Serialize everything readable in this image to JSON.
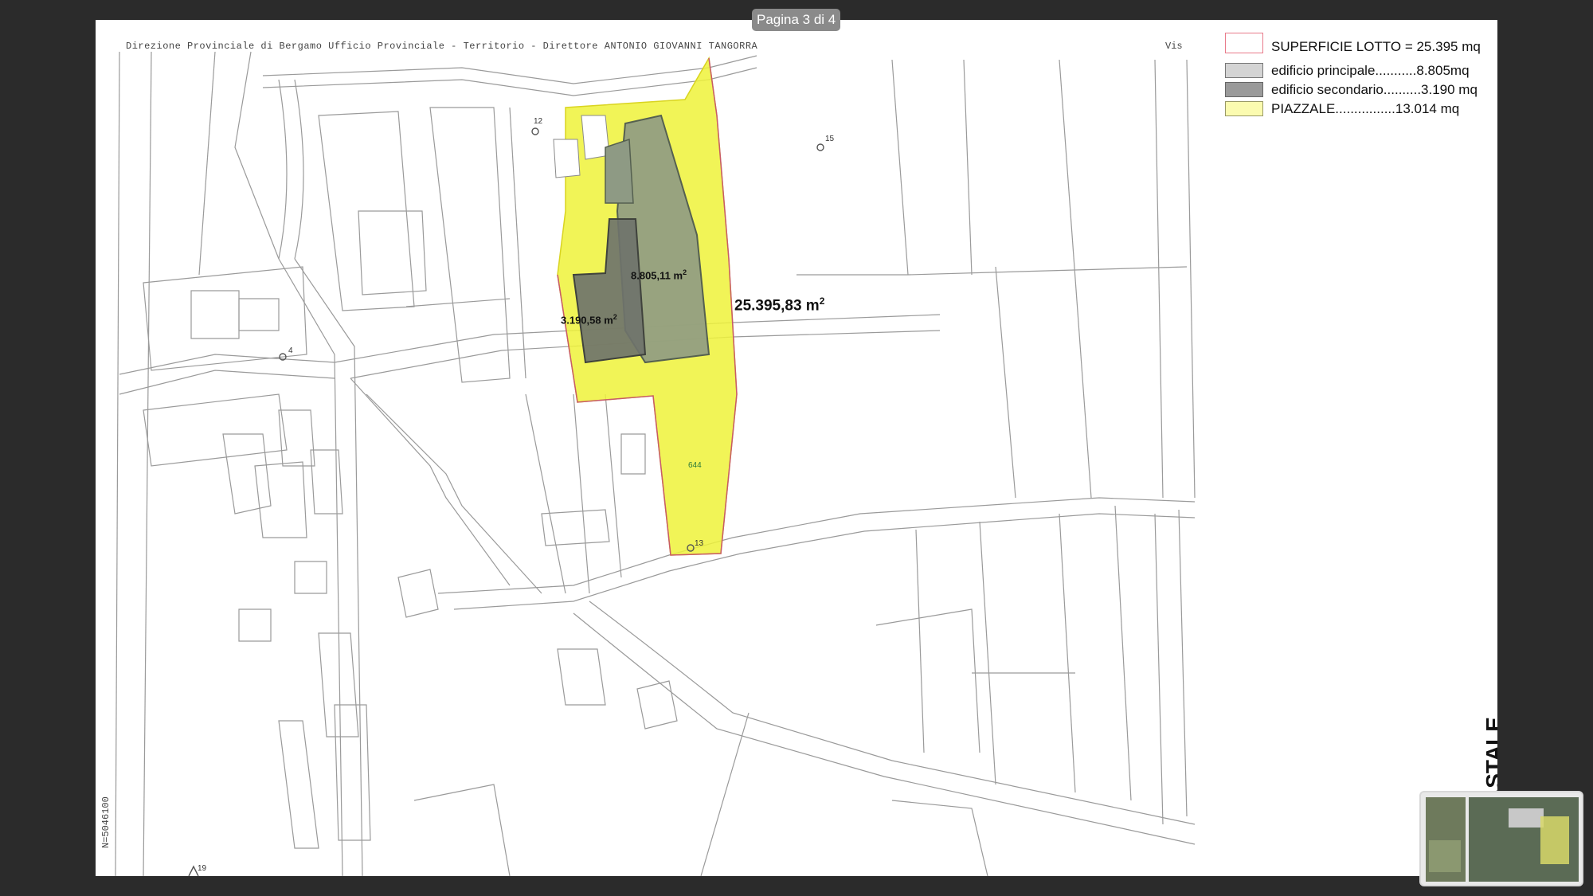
{
  "viewer": {
    "page_indicator": "Pagina 3 di 4"
  },
  "map": {
    "header_text": "Direzione Provinciale di Bergamo  Ufficio Provinciale - Territorio - Direttore ANTONIO GIOVANNI TANGORRA",
    "header_vis": "Vis",
    "side_coordinate": "N=5046100",
    "parcel_644": "644",
    "marker_13": "13",
    "marker_15": "15",
    "marker_12": "12",
    "marker_4": "4",
    "marker_19": "19"
  },
  "areas": {
    "main_building": {
      "value": "8.805,11 m",
      "exp": "2"
    },
    "secondary_building": {
      "value": "3.190,58 m",
      "exp": "2"
    },
    "total": {
      "value": "25.395,83 m",
      "exp": "2"
    }
  },
  "legend": {
    "items": [
      {
        "label": "SUPERFICIE LOTTO = 25.395 mq",
        "fill": "#ffffff",
        "border": "#e87a8a"
      },
      {
        "label": "edificio principale...........8.805mq",
        "fill": "#d4d4d4",
        "border": "#777777"
      },
      {
        "label": "edificio secondario..........3.190 mq",
        "fill": "#9a9a9a",
        "border": "#666666"
      },
      {
        "label": "PIAZZALE................13.014 mq",
        "fill": "#fbfbb0",
        "border": "#999966"
      }
    ]
  },
  "vertical_title": "TASTALE",
  "colors": {
    "yard": "#eef23a",
    "main_building": "#8e9a84",
    "secondary_building": "#6f736b",
    "lines": "#8a8a8a"
  }
}
